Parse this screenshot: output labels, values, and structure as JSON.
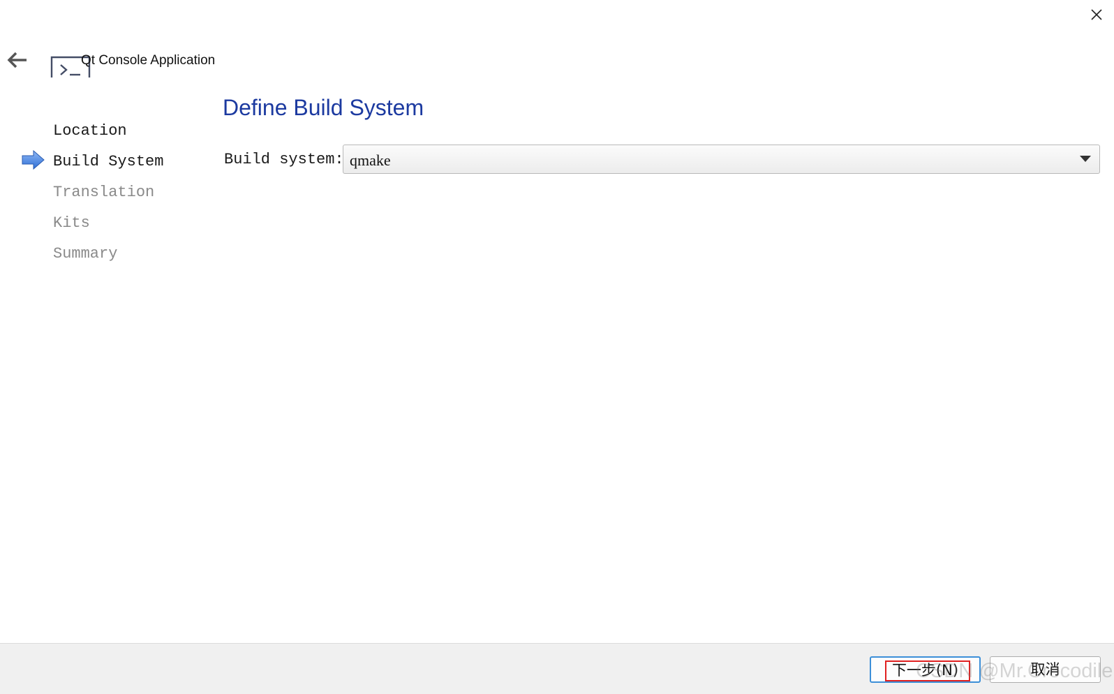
{
  "window": {
    "close_icon": "close-icon",
    "back_icon": "arrow-left-icon"
  },
  "header": {
    "title": "Qt Console Application",
    "icon": "terminal-icon"
  },
  "steps": [
    {
      "label": "Location",
      "state": "done"
    },
    {
      "label": "Build System",
      "state": "current"
    },
    {
      "label": "Translation",
      "state": "future"
    },
    {
      "label": "Kits",
      "state": "future"
    },
    {
      "label": "Summary",
      "state": "future"
    }
  ],
  "current_step_icon": "arrow-right-icon",
  "page": {
    "title": "Define Build System",
    "field_label": "Build system:",
    "build_system_value": "qmake"
  },
  "footer": {
    "next_label": "下一步(N)",
    "cancel_label": "取消"
  },
  "watermark": "CSDN @Mr.Crocodile",
  "colors": {
    "title_blue": "#1c3aa0",
    "step_arrow_blue": "#3d7de0",
    "highlight_red": "#e02020",
    "focus_blue": "#3c8fd8"
  }
}
